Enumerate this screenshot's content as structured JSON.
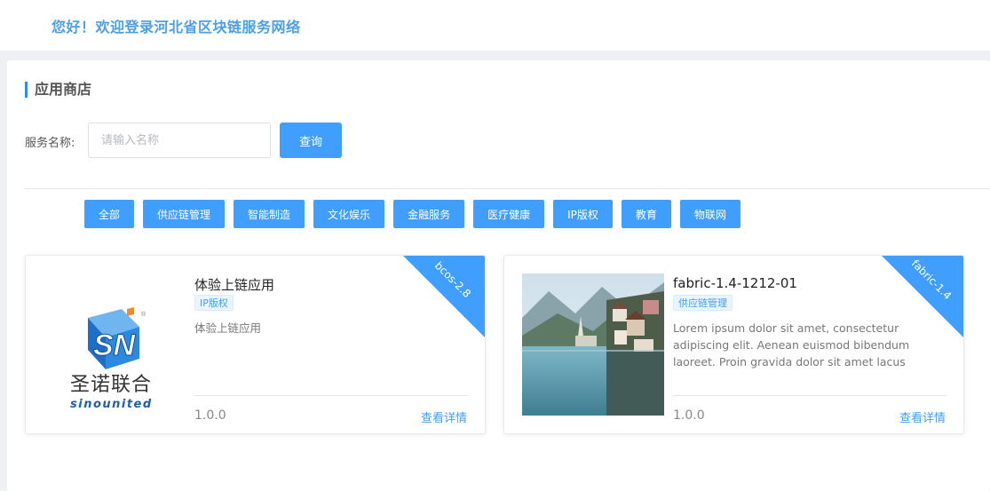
{
  "header": {
    "welcome": "您好！欢迎登录河北省区块链服务网络"
  },
  "page": {
    "title": "应用商店"
  },
  "search": {
    "label": "服务名称:",
    "placeholder": "请输入名称",
    "value": "",
    "button": "查询"
  },
  "categories": [
    "全部",
    "供应链管理",
    "智能制造",
    "文化娱乐",
    "金融服务",
    "医疗健康",
    "IP版权",
    "教育",
    "物联网"
  ],
  "cards": [
    {
      "ribbon": "bcos-2.8",
      "title": "体验上链应用",
      "tag": "IP版权",
      "description": "体验上链应用",
      "version": "1.0.0",
      "detail": "查看详情",
      "logo": {
        "cn": "圣诺联合",
        "en": "sinounited",
        "mark": "SN",
        "reg": "®"
      }
    },
    {
      "ribbon": "fabric-1.4",
      "title": "fabric-1.4-1212-01",
      "tag": "供应链管理",
      "description": "Lorem ipsum dolor sit amet, consectetur adipiscing elit. Aenean euismod bibendum laoreet. Proin gravida dolor sit amet lacus",
      "version": "1.0.0",
      "detail": "查看详情"
    }
  ],
  "colors": {
    "accent": "#409eff",
    "welcome": "#4a9fe8",
    "title_bar": "#2d8cf0"
  }
}
